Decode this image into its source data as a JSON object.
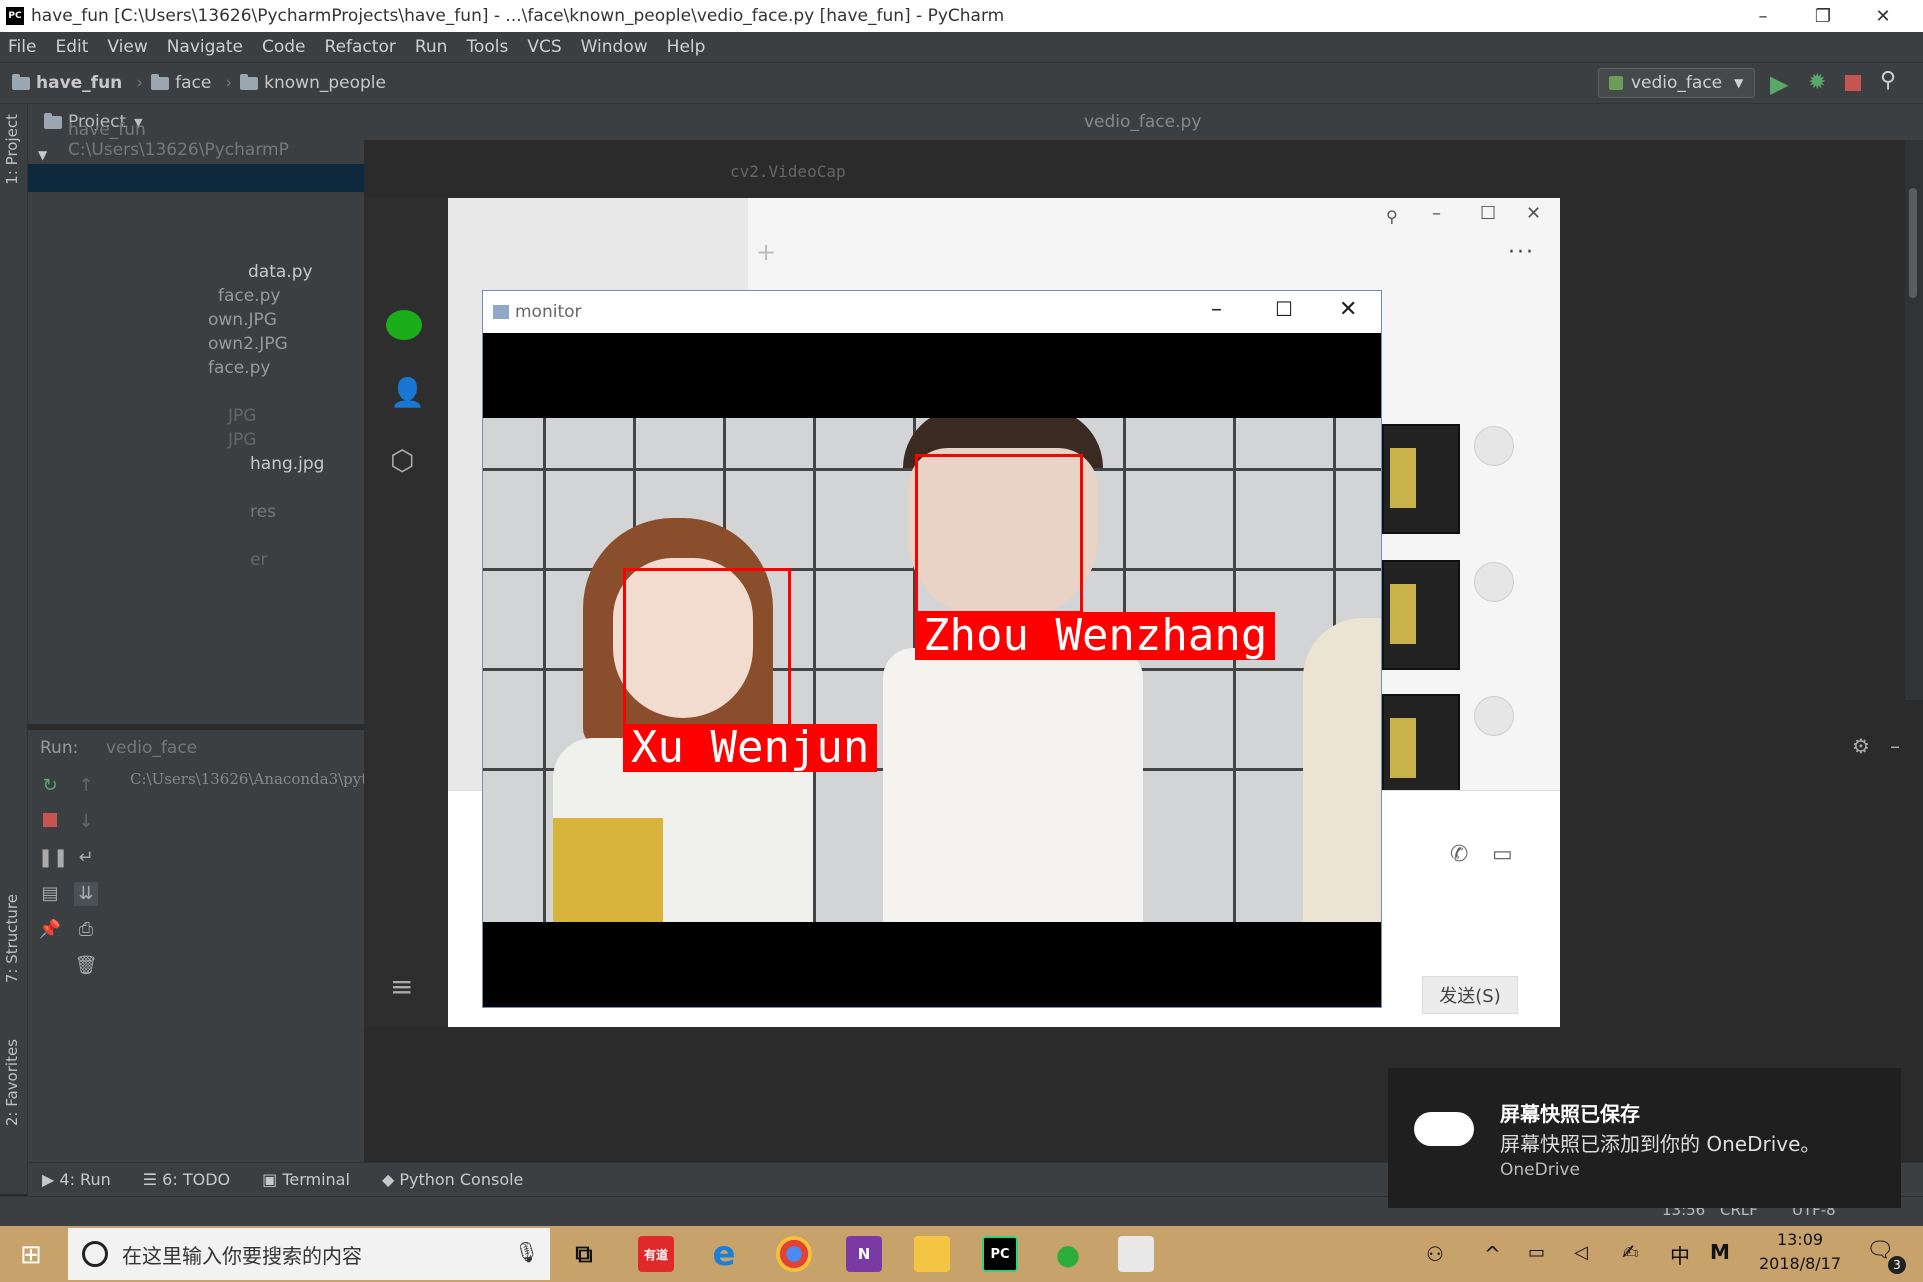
{
  "titlebar": {
    "title": "have_fun [C:\\Users\\13626\\PycharmProjects\\have_fun] - ...\\face\\known_people\\vedio_face.py [have_fun] - PyCharm",
    "minimize": "–",
    "restore": "❐",
    "close": "✕"
  },
  "menu": [
    "File",
    "Edit",
    "View",
    "Navigate",
    "Code",
    "Refactor",
    "Run",
    "Tools",
    "VCS",
    "Window",
    "Help"
  ],
  "breadcrumb": [
    "have_fun",
    "face",
    "known_people"
  ],
  "run_config": "vedio_face",
  "editor": {
    "tab": "vedio_face.py",
    "code_hint": "cv2.VideoCap"
  },
  "project_panel": {
    "title": "Project",
    "root": "have_fun  C:\\Users\\13626\\PycharmP",
    "files": [
      "data.py",
      "face.py",
      "own.JPG",
      "own2.JPG",
      "face.py",
      "JPG",
      "JPG",
      "hang.jpg",
      "res",
      "er"
    ]
  },
  "run_panel": {
    "label": "Run:",
    "tab": "vedio_face",
    "command": "C:\\Users\\13626\\Anaconda3\\pyt"
  },
  "left_tabs": {
    "project": "1: Project",
    "structure": "7: Structure",
    "favorites": "2: Favorites"
  },
  "bottom_tabs": [
    "4: Run",
    "6: TODO",
    "Terminal",
    "Python Console"
  ],
  "status": {
    "position": "13:56",
    "line_sep": "CRLF",
    "encoding": "UTF-8"
  },
  "monitor": {
    "title": "monitor",
    "faces": [
      {
        "name": "Xu Wenjun"
      },
      {
        "name": "Zhou Wenzhang"
      }
    ]
  },
  "wechat": {
    "send_button": "发送(S)",
    "more": "···"
  },
  "toast": {
    "title": "屏幕快照已保存",
    "body": "屏幕快照已添加到你的 OneDrive。",
    "source": "OneDrive"
  },
  "taskbar": {
    "search_placeholder": "在这里输入你要搜索的内容",
    "time": "13:09",
    "date": "2018/8/17",
    "ime": "中",
    "notification_count": "3",
    "youdao_label": "有道",
    "pycharm_label": "PC",
    "onenote_label": "N"
  }
}
